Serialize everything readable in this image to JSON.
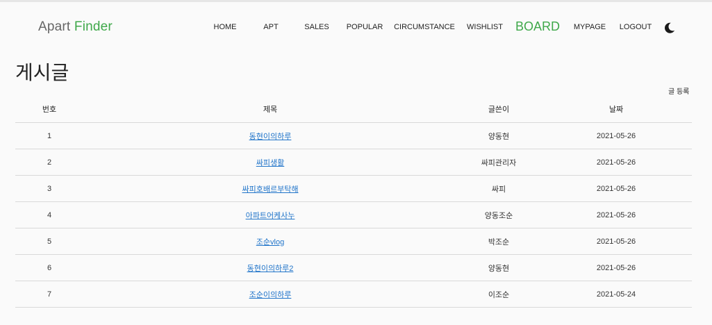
{
  "brand": {
    "part1": "Apart",
    "part2": "Finder"
  },
  "nav": {
    "home": "HOME",
    "apt": "APT",
    "sales": "SALES",
    "popular": "POPULAR",
    "circumstance": "CIRCUMSTANCE",
    "wishlist": "WISHLIST",
    "board": "BOARD",
    "mypage": "MYPAGE",
    "logout": "LOGOUT",
    "theme_icon": "moon-icon"
  },
  "page": {
    "title": "게시글",
    "write_button": "글 등록"
  },
  "table": {
    "headers": {
      "no": "번호",
      "title": "제목",
      "writer": "글쓴이",
      "date": "날짜"
    },
    "rows": [
      {
        "no": "1",
        "title": "동현이의하루",
        "writer": "양동현",
        "date": "2021-05-26"
      },
      {
        "no": "2",
        "title": "싸피생활",
        "writer": "싸피관리자",
        "date": "2021-05-26"
      },
      {
        "no": "3",
        "title": "싸피호배르부탁해",
        "writer": "싸피",
        "date": "2021-05-26"
      },
      {
        "no": "4",
        "title": "아파트어케사누",
        "writer": "양동조순",
        "date": "2021-05-26"
      },
      {
        "no": "5",
        "title": "조순vlog",
        "writer": "박조순",
        "date": "2021-05-26"
      },
      {
        "no": "6",
        "title": "동현이의하루2",
        "writer": "양동현",
        "date": "2021-05-26"
      },
      {
        "no": "7",
        "title": "조순이의하루",
        "writer": "이조순",
        "date": "2021-05-24"
      }
    ]
  },
  "colors": {
    "accent": "#3fa84a",
    "link": "#1e73c9",
    "background": "#fafafa"
  }
}
